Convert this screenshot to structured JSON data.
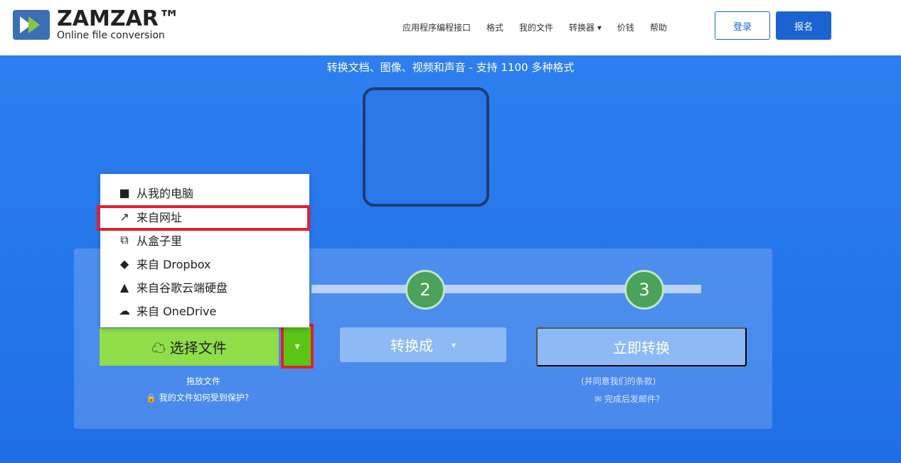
{
  "brand": {
    "name": "ZAMZAR™",
    "subtitle": "Online file conversion"
  },
  "nav": [
    "应用程序编程接口",
    "格式",
    "我的文件",
    "转换器 ▾",
    "价钱",
    "帮助"
  ],
  "actions": {
    "login": "登录",
    "signup": "报名"
  },
  "hero": {
    "tagline": "转换文档、图像、视频和声音 - 支持 1100 多种格式"
  },
  "menu": [
    "从我的电脑",
    "来自网址",
    "从盒子里",
    "来自 Dropbox",
    "来自谷歌云端硬盘",
    "来自 OneDrive"
  ],
  "steps": [
    "2",
    "3"
  ],
  "buttons": {
    "choose": "选择文件",
    "convert_to": "转换成",
    "convert_now": "立即转换"
  },
  "notes": {
    "drop": "拖放文件",
    "protection": "我的文件如何受到保护?",
    "terms": "(并同意我们的条款)",
    "email": "完成后发邮件?"
  }
}
